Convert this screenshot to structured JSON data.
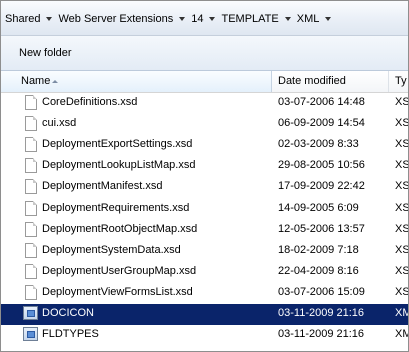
{
  "breadcrumb": {
    "items": [
      "Shared",
      "Web Server Extensions",
      "14",
      "TEMPLATE",
      "XML"
    ]
  },
  "toolbar": {
    "new_folder_label": "New folder"
  },
  "columns": {
    "name": "Name",
    "date_modified": "Date modified",
    "type": "Ty"
  },
  "files": [
    {
      "name": "CoreDefinitions.xsd",
      "date": "03-07-2006 14:48",
      "type": "XS",
      "icon": "xsd-file-icon"
    },
    {
      "name": "cui.xsd",
      "date": "06-09-2009 14:54",
      "type": "XS",
      "icon": "xsd-file-icon"
    },
    {
      "name": "DeploymentExportSettings.xsd",
      "date": "02-03-2009 8:33",
      "type": "XS",
      "icon": "xsd-file-icon"
    },
    {
      "name": "DeploymentLookupListMap.xsd",
      "date": "29-08-2005 10:56",
      "type": "XS",
      "icon": "xsd-file-icon"
    },
    {
      "name": "DeploymentManifest.xsd",
      "date": "17-09-2009 22:42",
      "type": "XS",
      "icon": "xsd-file-icon"
    },
    {
      "name": "DeploymentRequirements.xsd",
      "date": "14-09-2005 6:09",
      "type": "XS",
      "icon": "xsd-file-icon"
    },
    {
      "name": "DeploymentRootObjectMap.xsd",
      "date": "12-05-2006 13:57",
      "type": "XS",
      "icon": "xsd-file-icon"
    },
    {
      "name": "DeploymentSystemData.xsd",
      "date": "18-02-2009 7:18",
      "type": "XS",
      "icon": "xsd-file-icon"
    },
    {
      "name": "DeploymentUserGroupMap.xsd",
      "date": "22-04-2009 8:16",
      "type": "XS",
      "icon": "xsd-file-icon"
    },
    {
      "name": "DeploymentViewFormsList.xsd",
      "date": "03-07-2006 15:09",
      "type": "XS",
      "icon": "xsd-file-icon"
    },
    {
      "name": "DOCICON",
      "date": "03-11-2009 21:16",
      "type": "XM",
      "icon": "xml-file-icon",
      "selected": true
    },
    {
      "name": "FLDTYPES",
      "date": "03-11-2009 21:16",
      "type": "XM",
      "icon": "xml-file-icon"
    }
  ],
  "colors": {
    "selection": "#0a246a",
    "selection_text": "#ffffff"
  }
}
